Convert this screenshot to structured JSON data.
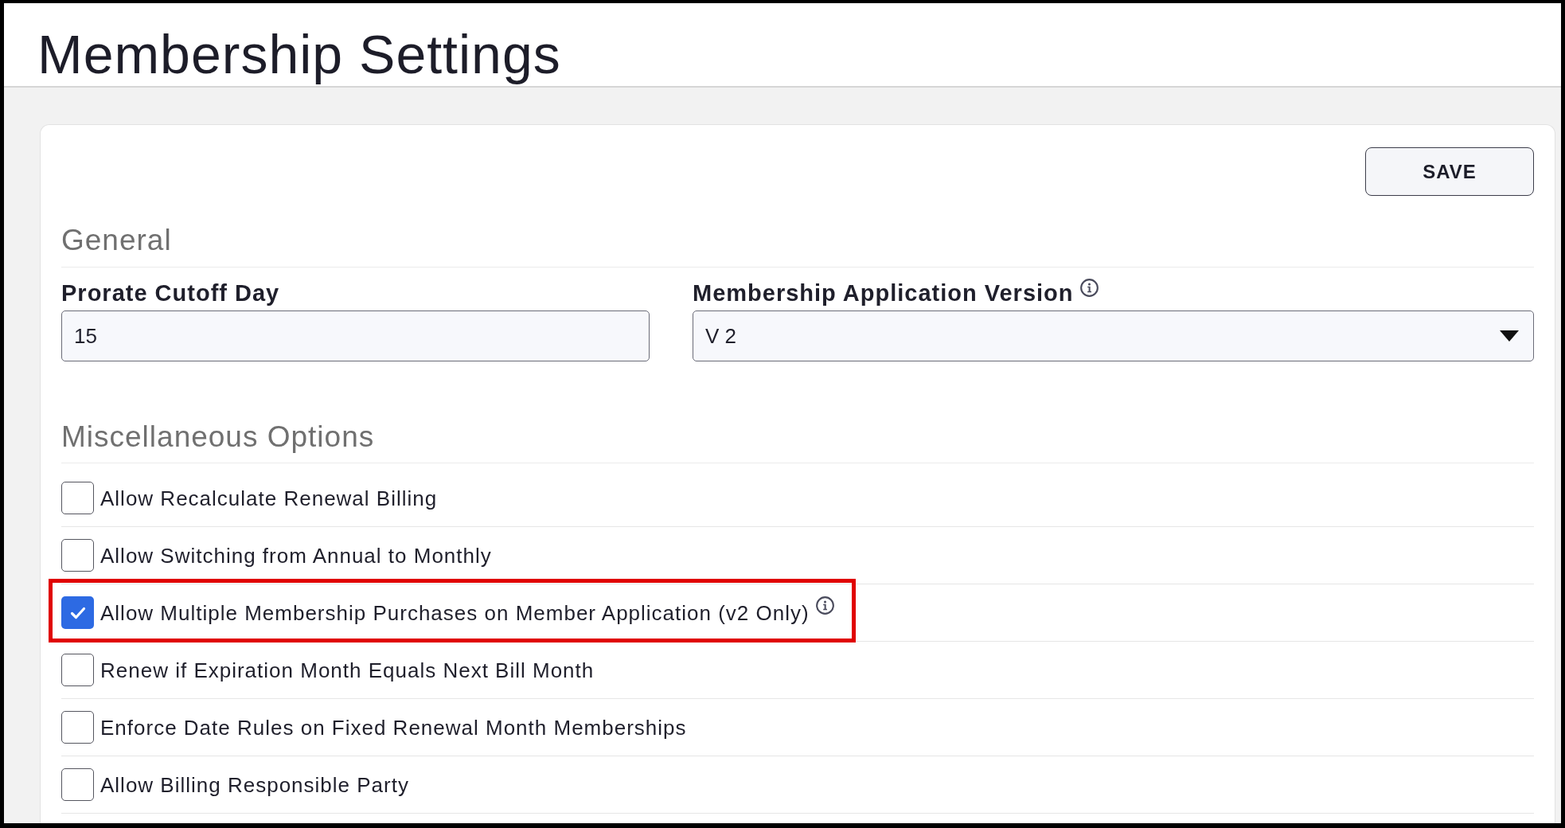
{
  "page": {
    "title": "Membership Settings"
  },
  "save_button": {
    "label": "SAVE"
  },
  "general": {
    "heading": "General",
    "prorate_cutoff_day": {
      "label": "Prorate Cutoff Day",
      "value": "15"
    },
    "application_version": {
      "label": "Membership Application Version",
      "info": true,
      "value": "V 2"
    }
  },
  "miscellaneous": {
    "heading": "Miscellaneous Options",
    "options": [
      {
        "label": "Allow Recalculate Renewal Billing",
        "checked": false,
        "info": false,
        "highlighted": false
      },
      {
        "label": "Allow Switching from Annual to Monthly",
        "checked": false,
        "info": false,
        "highlighted": false
      },
      {
        "label": "Allow Multiple Membership Purchases on Member Application (v2 Only)",
        "checked": true,
        "info": true,
        "highlighted": true
      },
      {
        "label": "Renew if Expiration Month Equals Next Bill Month",
        "checked": false,
        "info": false,
        "highlighted": false
      },
      {
        "label": "Enforce Date Rules on Fixed Renewal Month Memberships",
        "checked": false,
        "info": false,
        "highlighted": false
      },
      {
        "label": "Allow Billing Responsible Party",
        "checked": false,
        "info": false,
        "highlighted": false
      }
    ]
  }
}
